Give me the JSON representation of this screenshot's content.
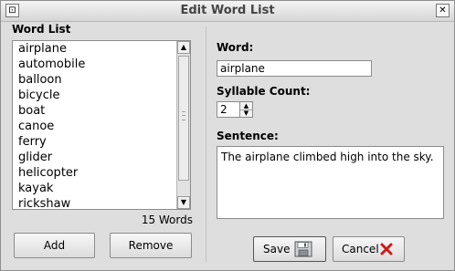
{
  "window": {
    "title": "Edit Word List",
    "left_button_glyph": "⊡",
    "close_glyph": "✕"
  },
  "word_list": {
    "label": "Word List",
    "items": [
      "airplane",
      "automobile",
      "balloon",
      "bicycle",
      "boat",
      "canoe",
      "ferry",
      "glider",
      "helicopter",
      "kayak",
      "rickshaw"
    ],
    "count_text": "15 Words",
    "scroll_up_glyph": "▲",
    "scroll_down_glyph": "▼"
  },
  "buttons": {
    "add": "Add",
    "remove": "Remove",
    "save": "Save",
    "cancel": "Cancel"
  },
  "editor": {
    "word_label": "Word:",
    "word_value": "airplane",
    "syllable_label": "Syllable Count:",
    "syllable_value": "2",
    "spin_up_glyph": "▲",
    "spin_down_glyph": "▼",
    "sentence_label": "Sentence:",
    "sentence_value": "The airplane climbed high into the sky."
  },
  "icons": {
    "save": "floppy-disk-icon",
    "cancel": "red-x-icon"
  },
  "colors": {
    "cancel_x": "#d01a1a",
    "window_bg": "#dedede"
  }
}
